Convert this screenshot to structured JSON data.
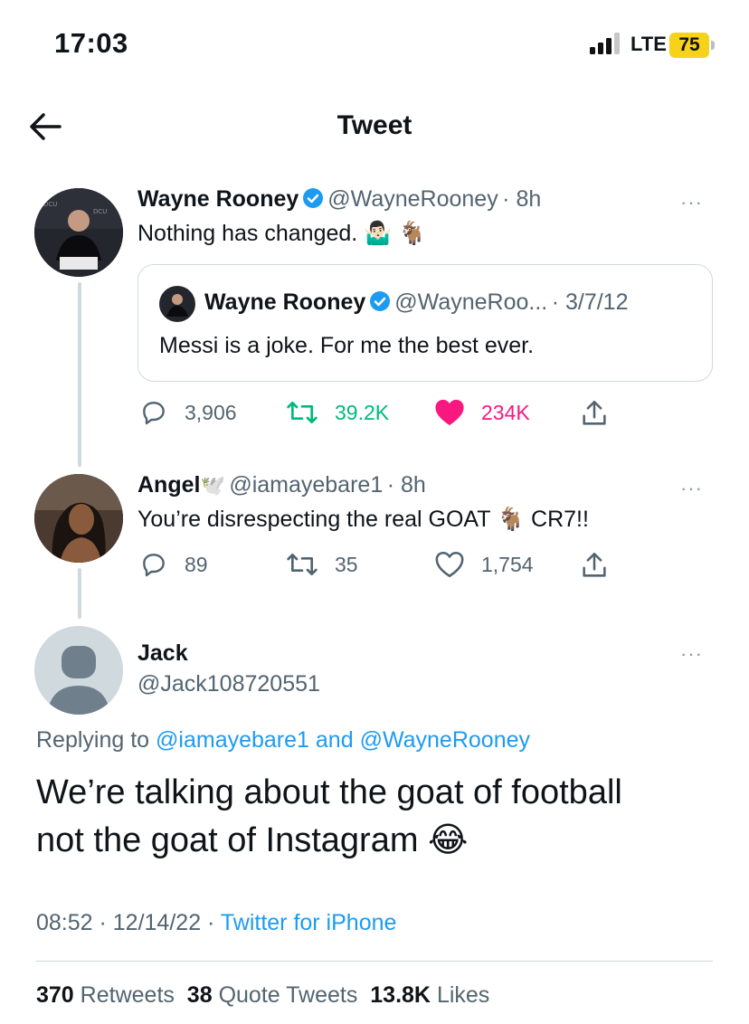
{
  "status_bar": {
    "time": "17:03",
    "network": "LTE",
    "battery": "75"
  },
  "header": {
    "title": "Tweet"
  },
  "colors": {
    "accent": "#1d9bf0",
    "retweet": "#00ba7c",
    "like": "#f91880",
    "battery": "#f7d21b"
  },
  "tweet1": {
    "name": "Wayne Rooney",
    "handle": "@WayneRooney",
    "time": "· 8h",
    "text": "Nothing has changed.",
    "emoji": "🤷🏻‍♂️ 🐐",
    "quote": {
      "name": "Wayne Rooney",
      "handle": "@WayneRoo...",
      "time": "· 3/7/12",
      "text": "Messi is a joke. For me the best ever."
    },
    "replies": "3,906",
    "retweets": "39.2K",
    "likes": "234K"
  },
  "tweet2": {
    "name": "Angel",
    "name_emoji": "🕊️",
    "handle": "@iamayebare1",
    "time": "· 8h",
    "text": "You’re disrespecting the real GOAT 🐐  CR7!!",
    "replies": "89",
    "retweets": "35",
    "likes": "1,754"
  },
  "main_tweet": {
    "name": "Jack",
    "handle": "@Jack108720551",
    "replying_prefix": "Replying to",
    "replying_user1": "@iamayebare1",
    "replying_and": "and",
    "replying_user2": "@WayneRooney",
    "text_line1": "We’re talking about the goat of football",
    "text_line2": "not the goat of Instagram 😂",
    "time": "08:52 · 12/14/22 ·",
    "source": "Twitter for iPhone",
    "retweets_count": "370",
    "retweets_label": "Retweets",
    "quotes_count": "38",
    "quotes_label": "Quote Tweets",
    "likes_count": "13.8K",
    "likes_label": "Likes"
  },
  "more_icon": "···"
}
